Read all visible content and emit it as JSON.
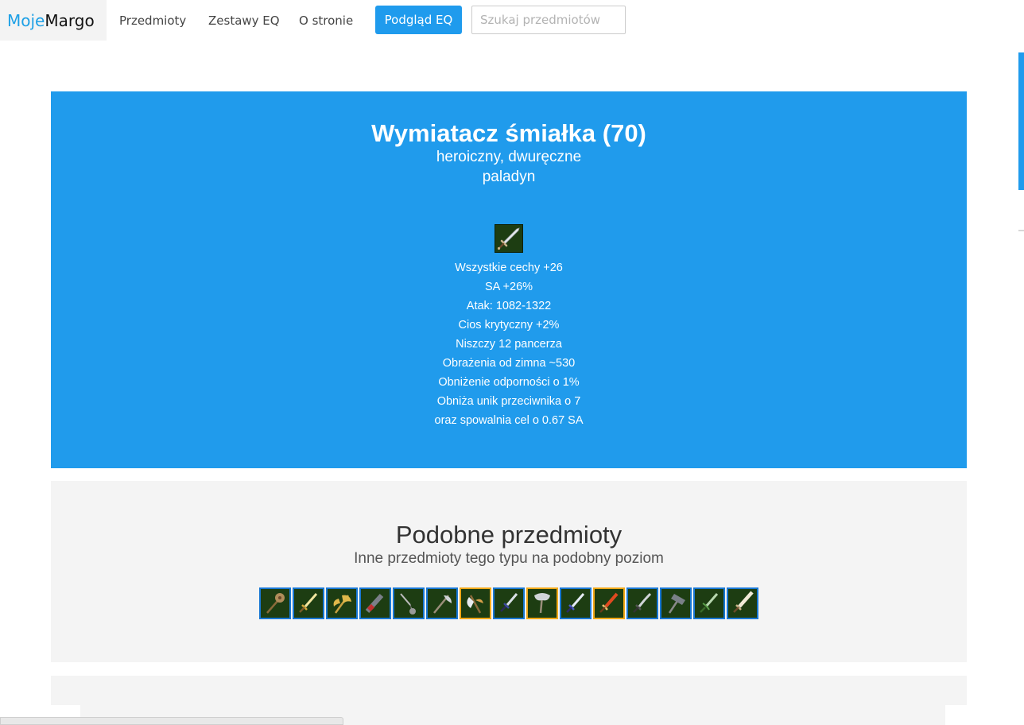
{
  "navbar": {
    "brand_part1": "Moje",
    "brand_part2": "Margo",
    "links": [
      "Przedmioty",
      "Zestawy EQ",
      "O stronie"
    ],
    "preview_button": "Podgląd EQ",
    "search_placeholder": "Szukaj przedmiotów",
    "search_value": ""
  },
  "item": {
    "title": "Wymiatacz śmiałka (70)",
    "subtitle1": "heroiczny, dwuręczne",
    "subtitle2": "paladyn",
    "icon": "two-handed-sword-icon",
    "stats": [
      "Wszystkie cechy +26",
      "SA +26%",
      "Atak: 1082-1322",
      "Cios krytyczny +2%",
      "Niszczy 12 pancerza",
      "Obrażenia od zimna ~530",
      "Obniżenie odporności o 1%",
      "Obniża unik przeciwnika o 7",
      "oraz spowalnia cel o 0.67 SA"
    ]
  },
  "similar": {
    "heading": "Podobne przedmioty",
    "lead": "Inne przedmioty tego typu na podobny poziom",
    "items": [
      {
        "icon": "mace-icon",
        "rarity": "heroic"
      },
      {
        "icon": "sword-icon",
        "rarity": "heroic"
      },
      {
        "icon": "axe-icon",
        "rarity": "heroic"
      },
      {
        "icon": "chainsaw-blade-icon",
        "rarity": "normal"
      },
      {
        "icon": "flail-icon",
        "rarity": "heroic"
      },
      {
        "icon": "halberd-icon",
        "rarity": "heroic"
      },
      {
        "icon": "battle-axe-icon",
        "rarity": "legendary"
      },
      {
        "icon": "dagger-icon",
        "rarity": "heroic"
      },
      {
        "icon": "double-axe-icon",
        "rarity": "legendary"
      },
      {
        "icon": "blue-sword-icon",
        "rarity": "heroic"
      },
      {
        "icon": "fire-sword-icon",
        "rarity": "legendary"
      },
      {
        "icon": "curved-blade-icon",
        "rarity": "heroic"
      },
      {
        "icon": "hammer-icon",
        "rarity": "heroic"
      },
      {
        "icon": "thorn-sword-icon",
        "rarity": "heroic"
      },
      {
        "icon": "greatsword-icon",
        "rarity": "heroic"
      }
    ]
  },
  "colors": {
    "accent": "#209bec",
    "heroic_border": "#1877d4",
    "legendary_border": "#f0a818",
    "panel_bg": "#f4f4f4"
  }
}
